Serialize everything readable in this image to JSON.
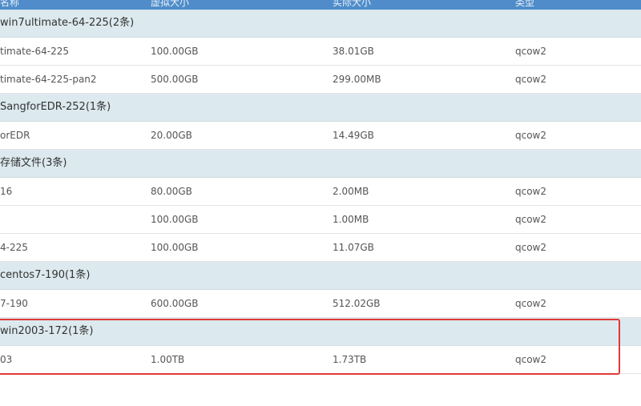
{
  "header": {
    "col1": "名称",
    "col2": "虚拟大小",
    "col3": "实际大小",
    "col4": "类型"
  },
  "groups": [
    {
      "title": "win7ultimate-64-225(2条)",
      "rows": [
        {
          "name": "timate-64-225",
          "virtual": "100.00GB",
          "actual": "38.01GB",
          "type": "qcow2"
        },
        {
          "name": "timate-64-225-pan2",
          "virtual": "500.00GB",
          "actual": "299.00MB",
          "type": "qcow2"
        }
      ]
    },
    {
      "title": "SangforEDR-252(1条)",
      "rows": [
        {
          "name": "orEDR",
          "virtual": "20.00GB",
          "actual": "14.49GB",
          "type": "qcow2"
        }
      ]
    },
    {
      "title": "存储文件(3条)",
      "rows": [
        {
          "name": "16",
          "virtual": "80.00GB",
          "actual": "2.00MB",
          "type": "qcow2"
        },
        {
          "name": "",
          "virtual": "100.00GB",
          "actual": "1.00MB",
          "type": "qcow2"
        },
        {
          "name": "4-225",
          "virtual": "100.00GB",
          "actual": "11.07GB",
          "type": "qcow2"
        }
      ]
    },
    {
      "title": "centos7-190(1条)",
      "rows": [
        {
          "name": "7-190",
          "virtual": "600.00GB",
          "actual": "512.02GB",
          "type": "qcow2"
        }
      ]
    },
    {
      "title": "win2003-172(1条)",
      "rows": [
        {
          "name": "03",
          "virtual": "1.00TB",
          "actual": "1.73TB",
          "type": "qcow2"
        }
      ]
    }
  ],
  "colors": {
    "header": "#4f8cc9",
    "group_bg": "#dce9ee",
    "highlight": "#e03a3a"
  }
}
